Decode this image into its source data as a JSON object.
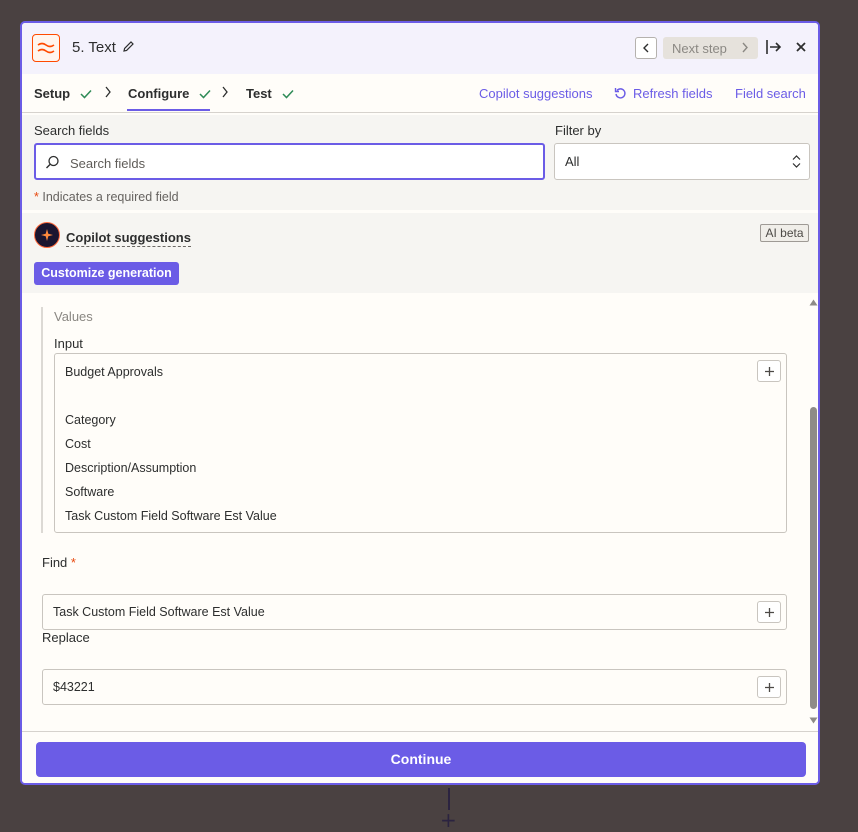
{
  "header": {
    "step_title": "5. Text",
    "next_step_label": "Next step"
  },
  "tabs": [
    {
      "label": "Setup",
      "complete": true
    },
    {
      "label": "Configure",
      "complete": true,
      "active": true
    },
    {
      "label": "Test",
      "complete": true
    }
  ],
  "links": {
    "copilot_suggestions": "Copilot suggestions",
    "refresh_fields": "Refresh fields",
    "field_search": "Field search"
  },
  "search": {
    "label": "Search fields",
    "placeholder": "Search fields",
    "value": ""
  },
  "filter": {
    "label": "Filter by",
    "value": "All"
  },
  "required_note": {
    "star": "*",
    "text": "Indicates a required field"
  },
  "copilot": {
    "label": "Copilot suggestions",
    "badge": "AI beta",
    "customize_button": "Customize generation"
  },
  "values_section": {
    "title": "Values",
    "input_label": "Input",
    "input_lines": [
      "Budget Approvals",
      "",
      "Category",
      "Cost",
      "Description/Assumption",
      "Software",
      "Task Custom Field Software Est Value"
    ]
  },
  "find": {
    "label": "Find",
    "required_star": "*",
    "value": "Task Custom Field Software Est Value"
  },
  "replace": {
    "label": "Replace",
    "value": "$43221"
  },
  "footer": {
    "continue_label": "Continue"
  },
  "colors": {
    "accent": "#6b5ce6",
    "brand_orange": "#ff4a00",
    "success_check": "#2e8b57",
    "required_star": "#e8490f"
  }
}
